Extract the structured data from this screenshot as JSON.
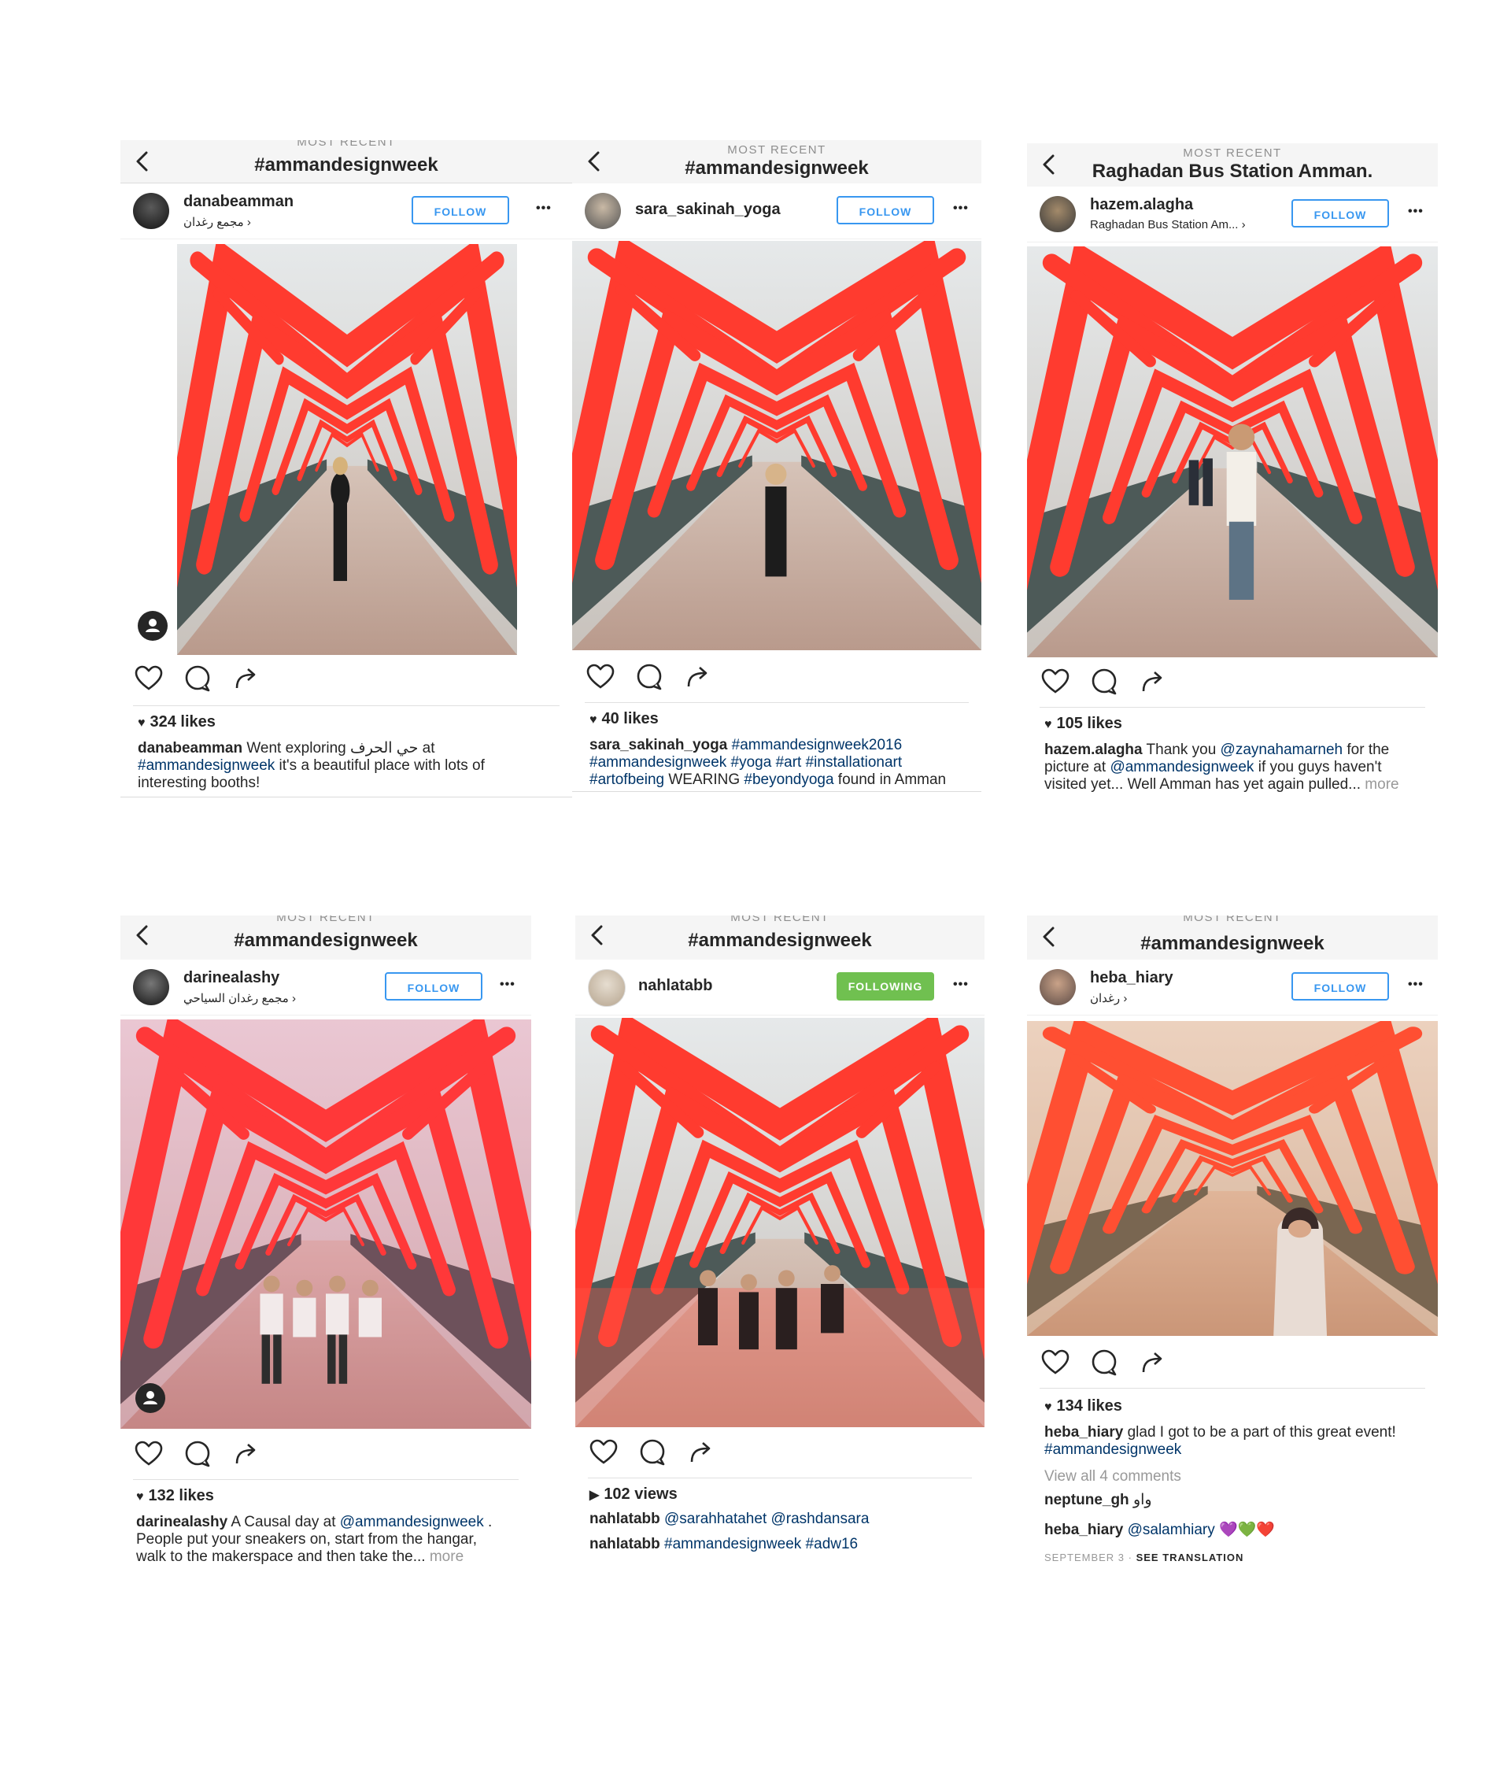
{
  "posts": [
    {
      "overline": "MOST RECENT",
      "title": "#ammandesignweek",
      "username": "danabeamman",
      "location": "مجمع رغدان ›",
      "follow_label": "FOLLOW",
      "more": "•••",
      "likes": "324 likes",
      "caption_user": "danabeamman",
      "caption_lines": [
        "Went exploring حي الحرف at",
        "#ammandesignweek",
        " it's a beautiful place with lots of",
        "interesting booths!"
      ]
    },
    {
      "overline": "MOST RECENT",
      "title": "#ammandesignweek",
      "username": "sara_sakinah_yoga",
      "follow_label": "FOLLOW",
      "more": "•••",
      "likes": "40 likes",
      "caption_user": "sara_sakinah_yoga",
      "caption_tag1": "#ammandesignweek2016",
      "caption_tag2": "#ammandesignweek #yoga #art #installationart",
      "caption_tag3": "#artofbeing",
      "caption_text3": " WEARING ",
      "caption_tag4": "#beyondyoga",
      "caption_text4": " found in Amman"
    },
    {
      "overline": "MOST RECENT",
      "title": "Raghadan Bus Station Amman.",
      "username": "hazem.alagha",
      "location": "Raghadan Bus Station Am... ›",
      "follow_label": "FOLLOW",
      "more": "•••",
      "likes": "105 likes",
      "caption_user": "hazem.alagha",
      "caption_text1": " Thank you ",
      "caption_tag1": "@zaynahamarneh",
      "caption_text2": " for the",
      "caption_text3": "picture at ",
      "caption_tag2": "@ammandesignweek",
      "caption_text4": " if you guys haven't",
      "caption_text5": "visited yet... Well Amman has yet again pulled... ",
      "caption_more": "more"
    },
    {
      "overline": "MOST RECENT",
      "title": "#ammandesignweek",
      "username": "darinealashy",
      "location": "مجمع رغدان السياحي ›",
      "follow_label": "FOLLOW",
      "more": "•••",
      "likes": "132 likes",
      "caption_user": "darinealashy",
      "caption_text1": " A Causal day at ",
      "caption_tag1": "@ammandesignweek",
      "caption_text2": " .",
      "caption_line2": "People put your sneakers on, start from the hangar,",
      "caption_line3": "walk to the makerspace and then take the... ",
      "caption_more": "more"
    },
    {
      "overline": "MOST RECENT",
      "title": "#ammandesignweek",
      "username": "nahlatabb",
      "follow_label": "FOLLOWING",
      "more": "•••",
      "views": "102 views",
      "c1_user": "nahlatabb",
      "c1_tags": "@sarahhatahet @rashdansara",
      "c2_user": "nahlatabb",
      "c2_tags": "#ammandesignweek #adw16"
    },
    {
      "overline": "MOST RECENT",
      "title": "#ammandesignweek",
      "username": "heba_hiary",
      "location": "رغدان ›",
      "follow_label": "FOLLOW",
      "more": "•••",
      "likes": "134 likes",
      "caption_user": "heba_hiary",
      "caption_text": " glad I got to be a part of this great event!",
      "caption_tag": "#ammandesignweek",
      "view_comments": "View all 4 comments",
      "c1_user": "neptune_gh",
      "c1_text": " واو",
      "c2_user": "heba_hiary",
      "c2_tag": "@salamhiary",
      "c2_emoji": " 💜💚❤️",
      "date": "SEPTEMBER 3 · ",
      "translate": "SEE TRANSLATION"
    }
  ],
  "colors": {
    "blue": "#3897f0",
    "green": "#70c050",
    "tag": "#003569",
    "frame_red": "#ff3b2f"
  }
}
